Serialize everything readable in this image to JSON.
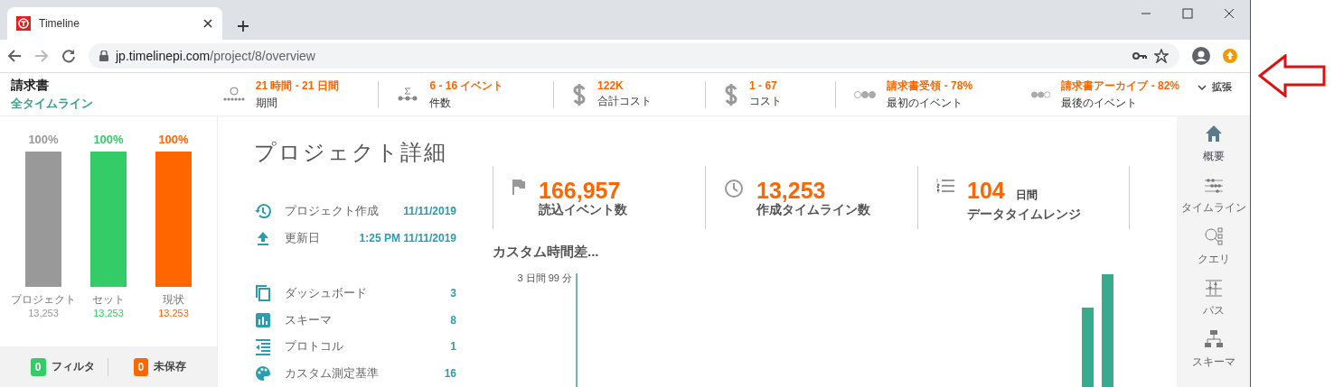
{
  "browser": {
    "tab": {
      "title": "Timeline"
    },
    "url": {
      "host": "jp.timelinepi.com",
      "path": "/project/8/overview"
    }
  },
  "header": {
    "title": "請求書",
    "subtitle": "全タイムライン",
    "stats": [
      {
        "value": "21 時間 - 21 日間",
        "label": "期間"
      },
      {
        "value": "6 - 16 イベント",
        "label": "件数"
      },
      {
        "value": "122K",
        "label": "合計コスト"
      },
      {
        "value": "1 - 67",
        "label": "コスト"
      },
      {
        "value": "請求書受領 - 78%",
        "label": "最初のイベント"
      },
      {
        "value": "請求書アーカイブ - 82%",
        "label": "最後のイベント"
      }
    ],
    "expand": "拡張"
  },
  "left_panel": {
    "bars": [
      {
        "percent": "100%",
        "label": "プロジェクト",
        "count": "13,253",
        "level": 1,
        "color": "#999999"
      },
      {
        "percent": "100%",
        "label": "セット",
        "count": "13,253",
        "level": 1,
        "color": "#33cc66"
      },
      {
        "percent": "100%",
        "label": "現状",
        "count": "13,253",
        "level": 1,
        "color": "#ff6600"
      }
    ],
    "footer": [
      {
        "count": "0",
        "label": "フィルタ",
        "color": "#33cc66"
      },
      {
        "count": "0",
        "label": "未保存",
        "color": "#ff6600"
      }
    ]
  },
  "main": {
    "title": "プロジェクト詳細",
    "info": [
      {
        "label": "プロジェクト作成",
        "value": "11/11/2019"
      },
      {
        "label": "更新日",
        "value": "1:25 PM 11/11/2019"
      }
    ],
    "counts": [
      {
        "label": "ダッシュボード",
        "value": "3"
      },
      {
        "label": "スキーマ",
        "value": "8"
      },
      {
        "label": "プロトコル",
        "value": "1"
      },
      {
        "label": "カスタム測定基準",
        "value": "16"
      }
    ],
    "cards": [
      {
        "value": "166,957",
        "label": "読込イベント数"
      },
      {
        "value": "13,253",
        "label": "作成タイムライン数"
      },
      {
        "value": "104",
        "unit": "日間",
        "label": "データタイムレンジ"
      }
    ],
    "chart": {
      "title": "カスタム時間差...",
      "tick_label": "3 日間 99 分"
    }
  },
  "sidebar": {
    "items": [
      {
        "label": "概要",
        "selected": true
      },
      {
        "label": "タイムライン",
        "selected": false
      },
      {
        "label": "クエリ",
        "selected": false
      },
      {
        "label": "パス",
        "selected": false
      },
      {
        "label": "スキーマ",
        "selected": false
      }
    ]
  }
}
